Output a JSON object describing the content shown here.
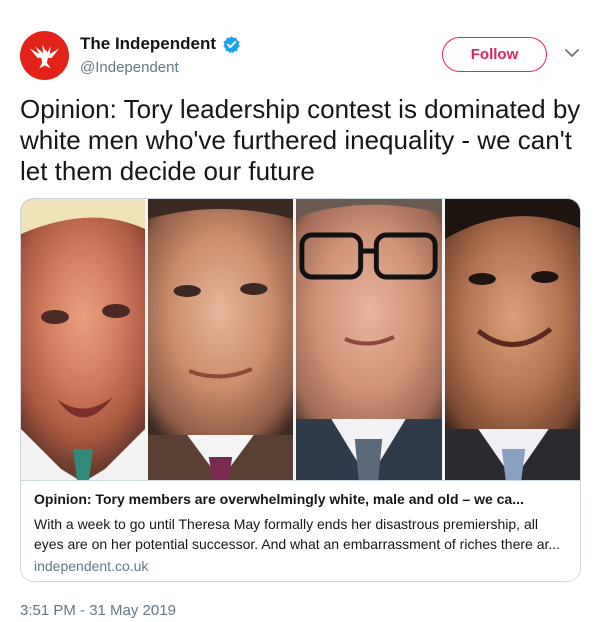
{
  "account": {
    "name": "The Independent",
    "handle": "@Independent",
    "avatar_icon": "eagle-icon",
    "brand_color": "#e2231a"
  },
  "follow_button": {
    "label": "Follow",
    "color": "#e0245e"
  },
  "tweet": {
    "text": "Opinion: Tory leadership contest is dominated by white men who've furthered inequality - we can't let them decide our future",
    "timestamp": "3:51 PM - 31 May 2019"
  },
  "card": {
    "title": "Opinion: Tory members are overwhelmingly white, male and old – we ca...",
    "description": "With a week to go until Theresa May formally ends her disastrous premiership, all eyes are on her potential successor. And what an embarrassment of riches there ar...",
    "domain": "independent.co.uk"
  },
  "colors": {
    "verified": "#1da1f2",
    "secondary_text": "#657786"
  }
}
